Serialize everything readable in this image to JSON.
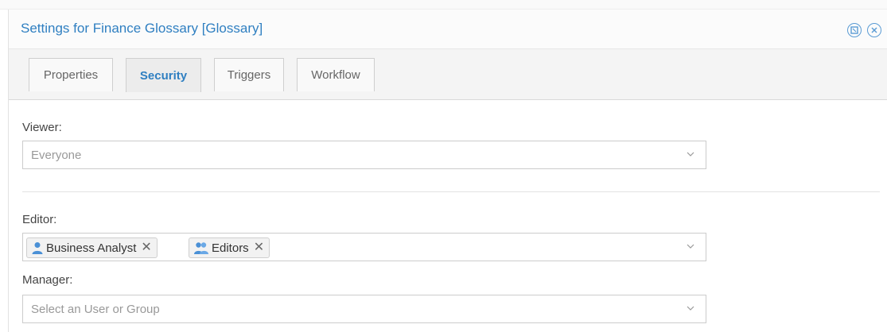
{
  "dialog": {
    "title": "Settings for Finance Glossary [Glossary]"
  },
  "tabs": [
    {
      "label": "Properties",
      "active": false
    },
    {
      "label": "Security",
      "active": true
    },
    {
      "label": "Triggers",
      "active": false
    },
    {
      "label": "Workflow",
      "active": false
    }
  ],
  "viewer": {
    "label": "Viewer:",
    "value": "Everyone"
  },
  "editor": {
    "label": "Editor:",
    "chips": [
      {
        "label": "Business Analyst",
        "icon": "user-icon"
      },
      {
        "label": "Editors",
        "icon": "group-icon"
      }
    ],
    "remove_glyph": "✕"
  },
  "manager": {
    "label": "Manager:",
    "placeholder": "Select an User or Group"
  },
  "colors": {
    "accent": "#2f7fc1",
    "icon_blue": "#4a90d6"
  }
}
